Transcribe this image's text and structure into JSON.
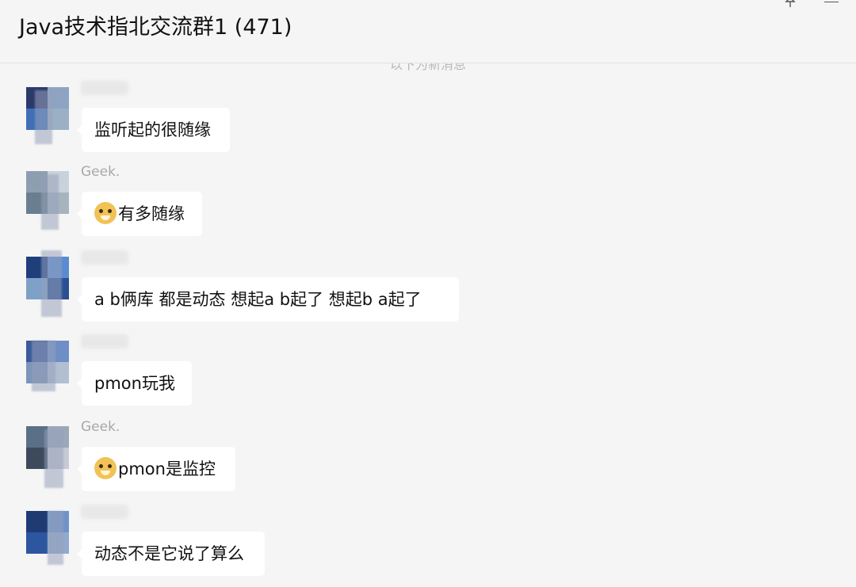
{
  "header": {
    "title": "Java技术指北交流群1 (471)"
  },
  "divider": {
    "label": "以下为新消息"
  },
  "messages": [
    {
      "sender": "",
      "text": "监听起的很随缘",
      "emoji": false,
      "avatar_colors": [
        "#2b3a6b",
        "#8fa3c2",
        "#3f6fb5",
        "#9bb0c4"
      ]
    },
    {
      "sender": "Geek.",
      "text": "有多随缘",
      "emoji": true,
      "avatar_colors": [
        "#8d9eb0",
        "#c9d2da",
        "#6b7e8f",
        "#a7b4bf"
      ]
    },
    {
      "sender": "",
      "text": "a b俩库 都是动态  想起a  b起了 想起b a起了",
      "emoji": false,
      "avatar_colors": [
        "#1f3f7a",
        "#5a8bd0",
        "#7fa1c8",
        "#2a4f92"
      ]
    },
    {
      "sender": "",
      "text": "pmon玩我",
      "emoji": false,
      "avatar_colors": [
        "#3a5a9a",
        "#6e8fc5",
        "#7d95b8",
        "#b1bfd3"
      ]
    },
    {
      "sender": "Geek.",
      "text": "pmon是监控",
      "emoji": true,
      "avatar_colors": [
        "#5b6f86",
        "#9aa9b8",
        "#3d4a5c",
        "#c6cbd3"
      ]
    },
    {
      "sender": "",
      "text": "动态不是它说了算么",
      "emoji": false,
      "avatar_colors": [
        "#1e3b74",
        "#6f93c9",
        "#2c56a0",
        "#93aacd"
      ]
    }
  ]
}
